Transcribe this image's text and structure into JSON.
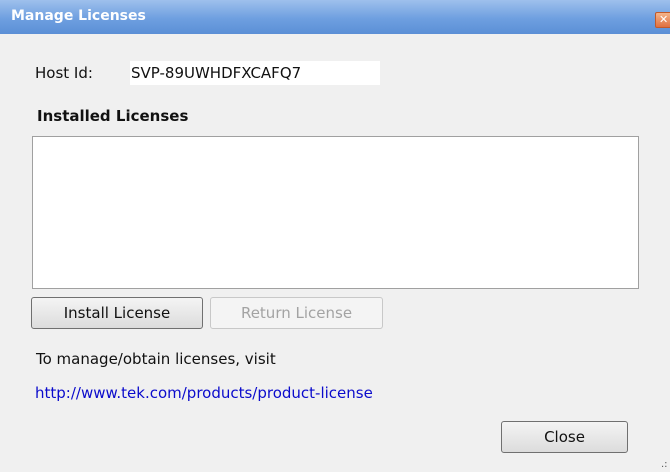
{
  "window": {
    "title": "Manage Licenses",
    "close_glyph": "✕"
  },
  "host": {
    "label": "Host Id:",
    "value": "SVP-89UWHDFXCAFQ7"
  },
  "licenses": {
    "heading": "Installed Licenses",
    "items": []
  },
  "buttons": {
    "install": "Install License",
    "return": "Return License",
    "close": "Close"
  },
  "info": {
    "text": "To manage/obtain licenses, visit",
    "link": "http://www.tek.com/products/product-license"
  },
  "colors": {
    "titlebar": "#6e9fe0",
    "link": "#0b0bcc",
    "disabled_text": "#a3a3a3"
  }
}
